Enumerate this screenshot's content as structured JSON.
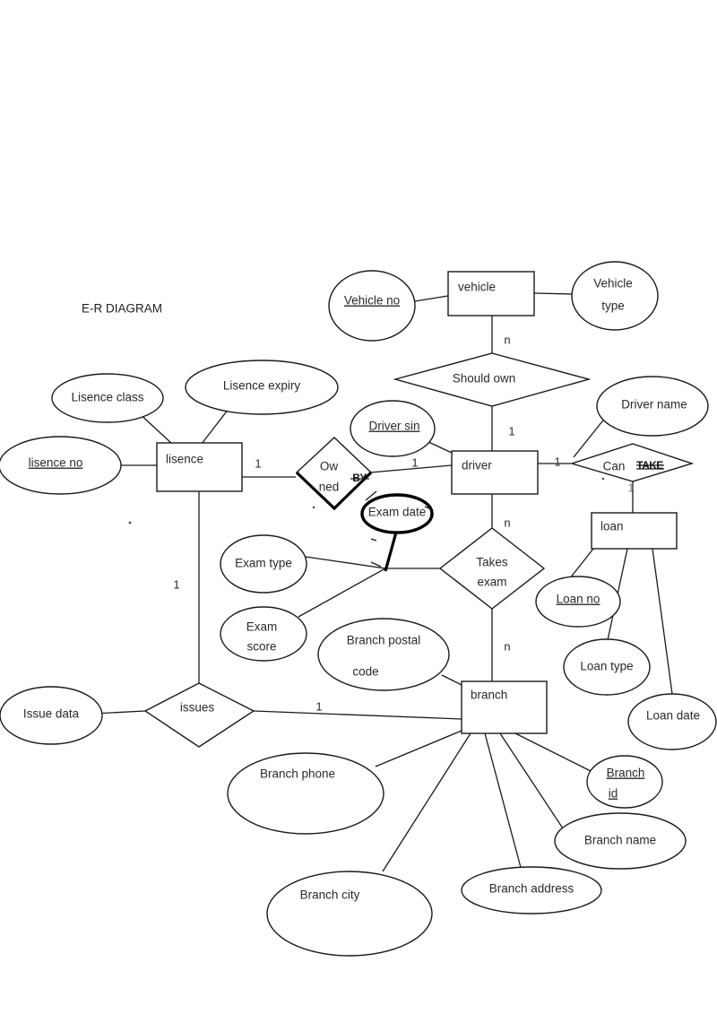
{
  "title": "E-R DIAGRAM",
  "entities": [
    {
      "id": "vehicle",
      "label": "vehicle"
    },
    {
      "id": "lisence",
      "label": "lisence"
    },
    {
      "id": "driver",
      "label": "driver"
    },
    {
      "id": "loan",
      "label": "loan"
    },
    {
      "id": "branch",
      "label": "branch"
    }
  ],
  "relationships": [
    {
      "id": "should-own",
      "label": "Should own"
    },
    {
      "id": "owned",
      "label_line1": "Ow",
      "label_line2": "ned",
      "overstrike": "BY"
    },
    {
      "id": "can-take",
      "label": "Can",
      "overstrike": "TAKE"
    },
    {
      "id": "takes-exam",
      "label_line1": "Takes",
      "label_line2": "exam"
    },
    {
      "id": "issues",
      "label": "issues"
    }
  ],
  "attributes": [
    {
      "id": "vehicle-no",
      "label": "Vehicle no",
      "key": true
    },
    {
      "id": "vehicle-type",
      "label_line1": "Vehicle",
      "label_line2": "type",
      "key": false
    },
    {
      "id": "lisence-class",
      "label": "Lisence class",
      "key": false
    },
    {
      "id": "lisence-expiry",
      "label": "Lisence expiry",
      "key": false
    },
    {
      "id": "lisence-no",
      "label": "lisence no",
      "key": true
    },
    {
      "id": "driver-sin",
      "label": "Driver sin",
      "key": true
    },
    {
      "id": "driver-name",
      "label": "Driver name",
      "key": false
    },
    {
      "id": "exam-date",
      "label": "Exam date",
      "key": false,
      "bold": true
    },
    {
      "id": "exam-type",
      "label": "Exam type",
      "key": false
    },
    {
      "id": "exam-score",
      "label_line1": "Exam",
      "label_line2": "score",
      "key": false
    },
    {
      "id": "loan-no",
      "label": "Loan no",
      "key": true
    },
    {
      "id": "loan-type",
      "label": "Loan type",
      "key": false
    },
    {
      "id": "loan-date",
      "label": "Loan date",
      "key": false
    },
    {
      "id": "branch-postal-code",
      "label_line1": "Branch postal",
      "label_line2": "code",
      "key": false
    },
    {
      "id": "branch-id",
      "label_line1": "Branch",
      "label_line2": "id",
      "key": true
    },
    {
      "id": "branch-name",
      "label": "Branch name",
      "key": false
    },
    {
      "id": "branch-address",
      "label": "Branch address",
      "key": false
    },
    {
      "id": "branch-city",
      "label": "Branch city",
      "key": false
    },
    {
      "id": "branch-phone",
      "label": "Branch phone",
      "key": false
    },
    {
      "id": "issue-data",
      "label": "Issue data",
      "key": false
    }
  ],
  "cardinalities": [
    {
      "id": "card-vehicle-shouldown",
      "value": "n"
    },
    {
      "id": "card-shouldown-driver",
      "value": "1"
    },
    {
      "id": "card-lisence-owned",
      "value": "1"
    },
    {
      "id": "card-owned-driver",
      "value": "1"
    },
    {
      "id": "card-driver-cantake",
      "value": "1"
    },
    {
      "id": "card-cantake-loan",
      "value": "1"
    },
    {
      "id": "card-driver-takesexam",
      "value": "n"
    },
    {
      "id": "card-takesexam-branch",
      "value": "n"
    },
    {
      "id": "card-lisence-issues",
      "value": "1"
    },
    {
      "id": "card-issues-branch",
      "value": "1"
    }
  ],
  "colors": {
    "stroke": "#1a1a1a",
    "text": "#2b2a28",
    "background": "#ffffff"
  }
}
